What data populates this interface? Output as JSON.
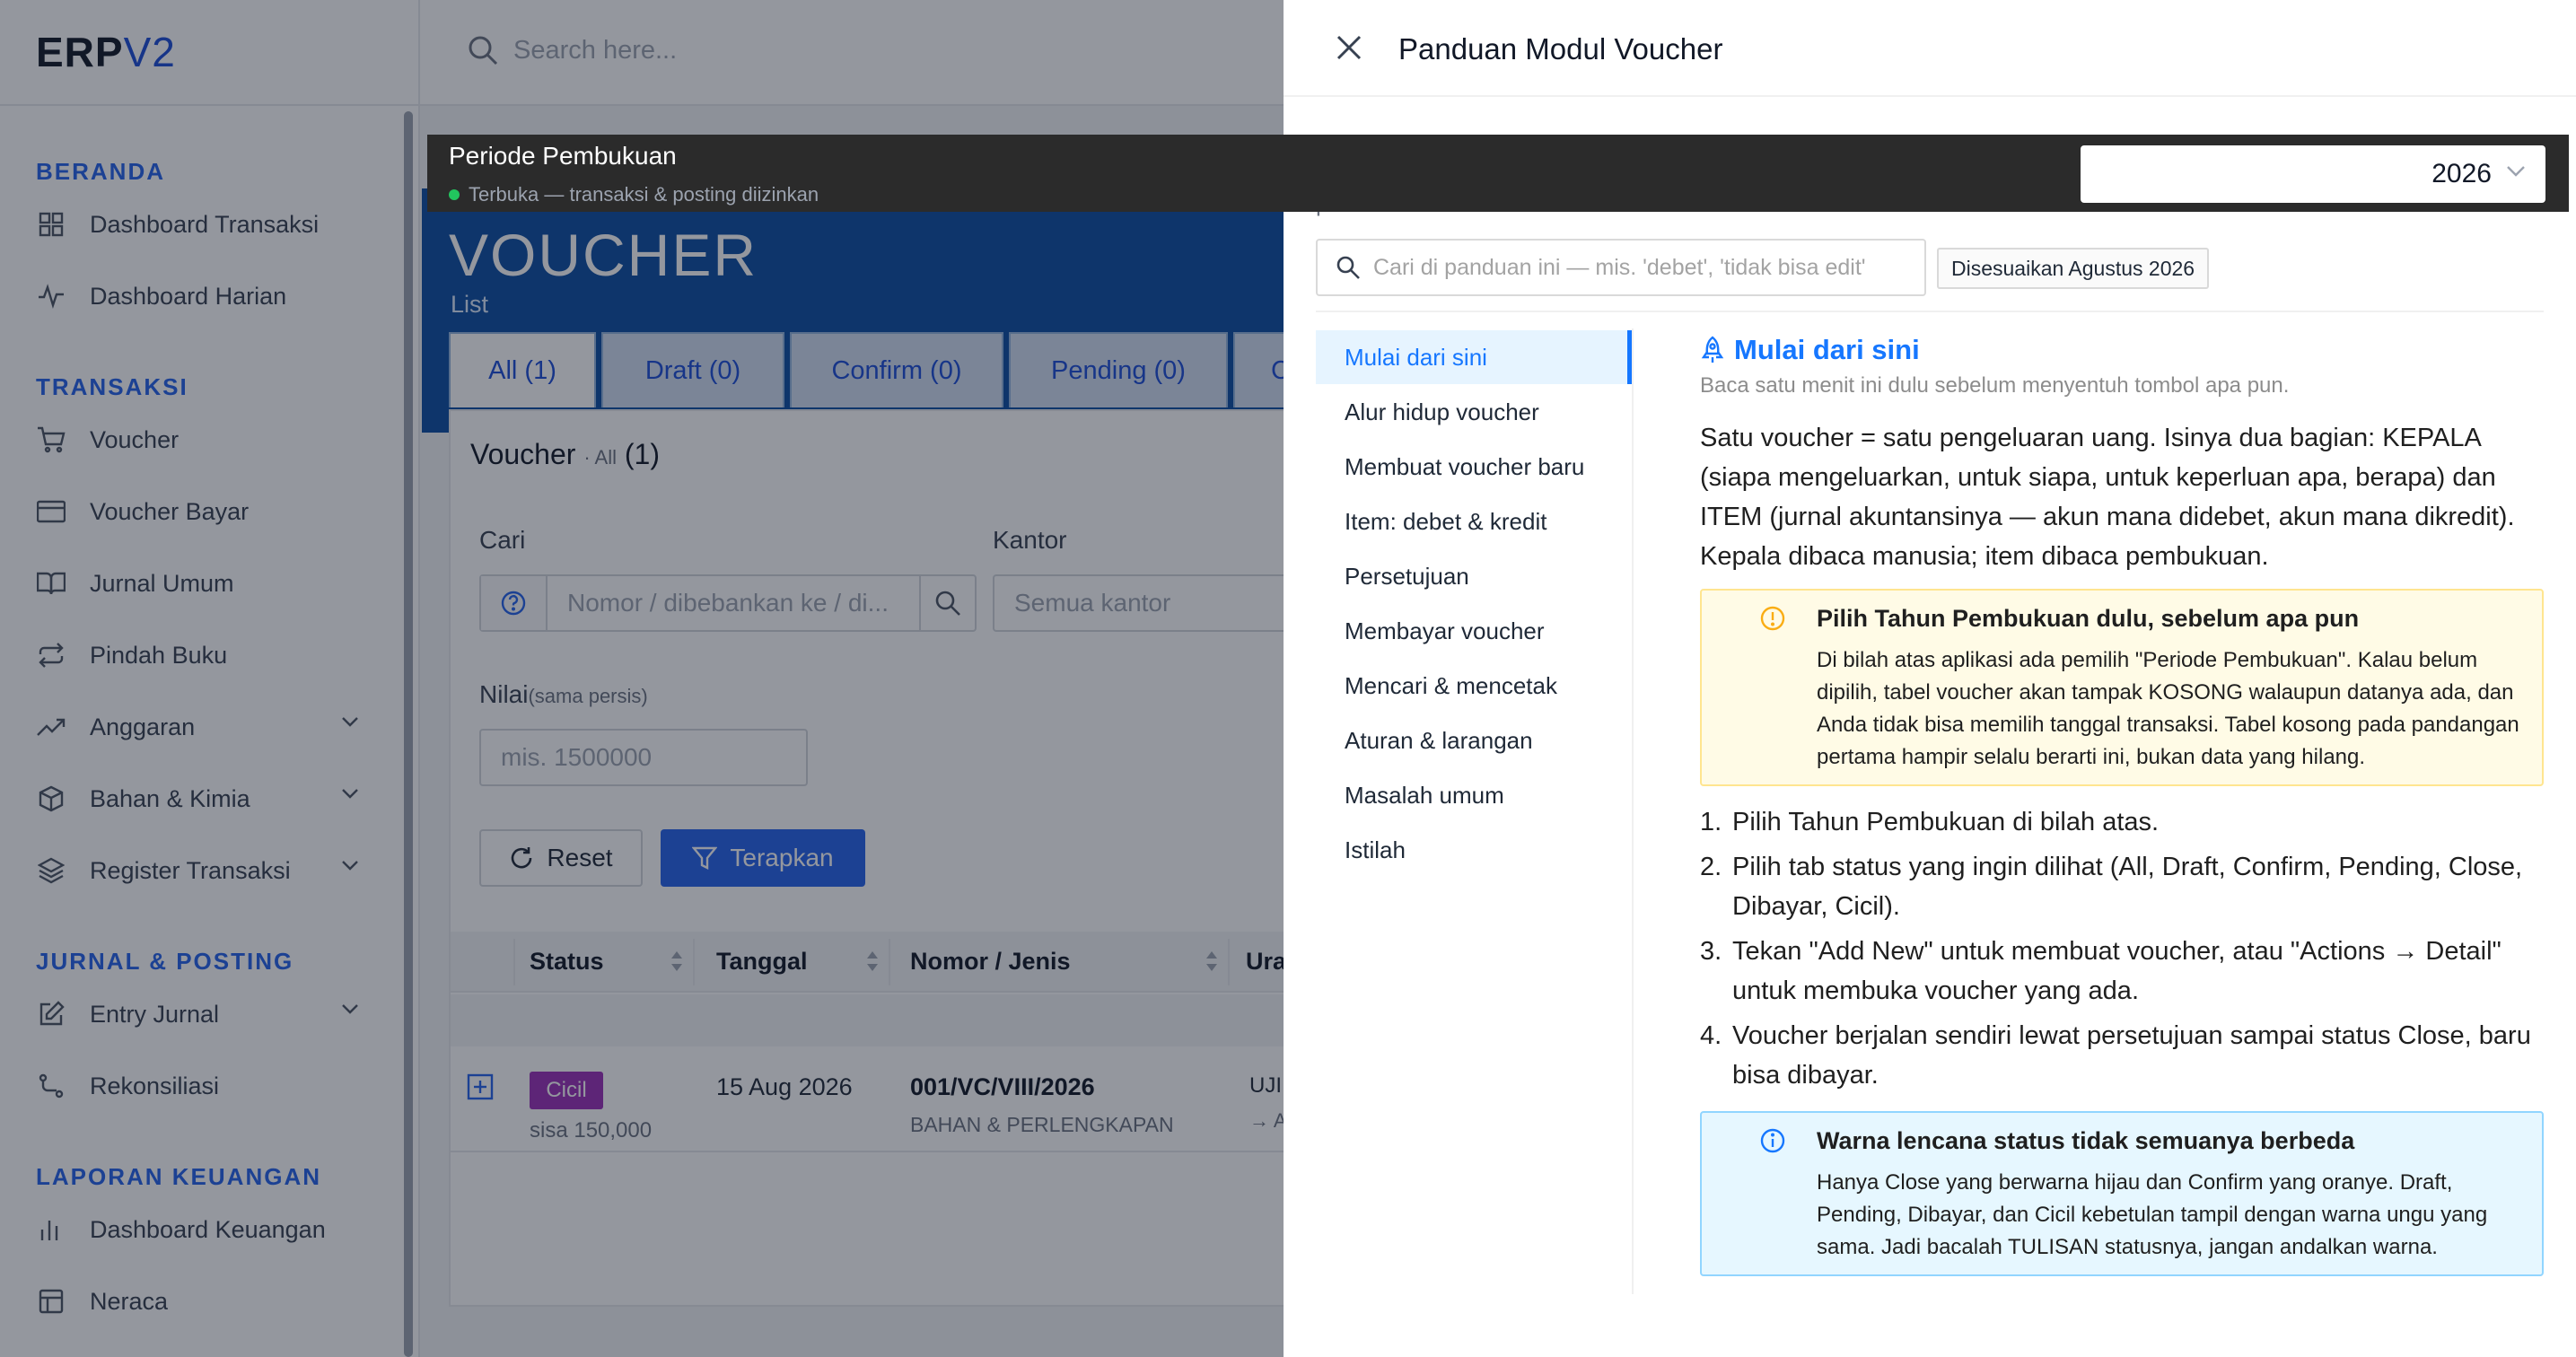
{
  "brand": {
    "part1": "ERP",
    "part2": "V2"
  },
  "topbar": {
    "search_placeholder": "Search here..."
  },
  "sidebar": {
    "sections": [
      {
        "title": "BERANDA",
        "items": [
          {
            "label": "Dashboard Transaksi",
            "icon": "grid-icon"
          },
          {
            "label": "Dashboard Harian",
            "icon": "activity-icon"
          }
        ]
      },
      {
        "title": "TRANSAKSI",
        "items": [
          {
            "label": "Voucher",
            "icon": "cart-icon"
          },
          {
            "label": "Voucher Bayar",
            "icon": "card-icon"
          },
          {
            "label": "Jurnal Umum",
            "icon": "book-icon"
          },
          {
            "label": "Pindah Buku",
            "icon": "transfer-icon"
          },
          {
            "label": "Anggaran",
            "icon": "trend-icon"
          },
          {
            "label": "Bahan & Kimia",
            "icon": "box-icon"
          },
          {
            "label": "Register Transaksi",
            "icon": "layers-icon"
          }
        ]
      },
      {
        "title": "JURNAL & POSTING",
        "items": [
          {
            "label": "Entry Jurnal",
            "icon": "edit-icon"
          },
          {
            "label": "Rekonsiliasi",
            "icon": "route-icon"
          }
        ]
      },
      {
        "title": "LAPORAN KEUANGAN",
        "items": [
          {
            "label": "Dashboard Keuangan",
            "icon": "bar-chart-icon"
          },
          {
            "label": "Neraca",
            "icon": "table-icon"
          }
        ]
      }
    ]
  },
  "period": {
    "title": "Periode Pembukuan",
    "status": "Terbuka — transaksi & posting diizinkan",
    "year": "2026"
  },
  "voucher_page": {
    "title": "VOUCHER",
    "subtitle": "List",
    "tabs": [
      "All (1)",
      "Draft (0)",
      "Confirm (0)",
      "Pending (0)",
      "C"
    ],
    "card_title": "Voucher",
    "card_filter": "· All",
    "card_count": "(1)",
    "filters": {
      "cari_label": "Cari",
      "cari_placeholder": "Nomor / dibebankan ke / di...",
      "kantor_label": "Kantor",
      "kantor_placeholder": "Semua kantor",
      "nilai_label": "Nilai",
      "nilai_hint": "(sama persis)",
      "nilai_placeholder": "mis. 1500000",
      "reset": "Reset",
      "apply": "Terapkan"
    },
    "table": {
      "headers": [
        "Status",
        "Tanggal",
        "Nomor / Jenis",
        "Ura"
      ],
      "rows": [
        {
          "status": "Cicil",
          "remaining": "sisa 150,000",
          "date": "15 Aug 2026",
          "number": "001/VC/VIII/2026",
          "type": "BAHAN & PERLENGKAPAN",
          "desc1": "UJI",
          "desc2": "→ A"
        }
      ]
    }
  },
  "drawer": {
    "title": "Panduan Modul Voucher",
    "intro_partial": "pembukuan.",
    "search_placeholder": "Cari di panduan ini — mis. 'debet', 'tidak bisa edit'",
    "tag": "Disesuaikan Agustus 2026",
    "menu": [
      "Mulai dari sini",
      "Alur hidup voucher",
      "Membuat voucher baru",
      "Item: debet & kredit",
      "Persetujuan",
      "Membayar voucher",
      "Mencari & mencetak",
      "Aturan & larangan",
      "Masalah umum",
      "Istilah"
    ],
    "section_title": "Mulai dari sini",
    "section_sub": "Baca satu menit ini dulu sebelum menyentuh tombol apa pun.",
    "body": "Satu voucher = satu pengeluaran uang. Isinya dua bagian: KEPALA (siapa mengeluarkan, untuk siapa, untuk keperluan apa, berapa) dan ITEM (jurnal akuntansinya — akun mana didebet, akun mana dikredit). Kepala dibaca manusia; item dibaca pembukuan.",
    "warning": {
      "title": "Pilih Tahun Pembukuan dulu, sebelum apa pun",
      "text": "Di bilah atas aplikasi ada pemilih \"Periode Pembukuan\". Kalau belum dipilih, tabel voucher akan tampak KOSONG walaupun datanya ada, dan Anda tidak bisa memilih tanggal transaksi. Tabel kosong pada pandangan pertama hampir selalu berarti ini, bukan data yang hilang."
    },
    "steps": [
      "Pilih Tahun Pembukuan di bilah atas.",
      "Pilih tab status yang ingin dilihat (All, Draft, Confirm, Pending, Close, Dibayar, Cicil).",
      "Tekan \"Add New\" untuk membuat voucher, atau \"Actions → Detail\" untuk membuka voucher yang ada.",
      "Voucher berjalan sendiri lewat persetujuan sampai status Close, baru bisa dibayar."
    ],
    "info": {
      "title": "Warna lencana status tidak semuanya berbeda",
      "text": "Hanya Close yang berwarna hijau dan Confirm yang oranye. Draft, Pending, Dibayar, dan Cicil kebetulan tampil dengan warna ungu yang sama. Jadi bacalah TULISAN statusnya, jangan andalkan warna."
    }
  },
  "colors": {
    "primary": "#2563eb",
    "hero": "#0b4ea2",
    "badge_cicil": "#9b30b8",
    "drawer_accent": "#1677ff"
  }
}
